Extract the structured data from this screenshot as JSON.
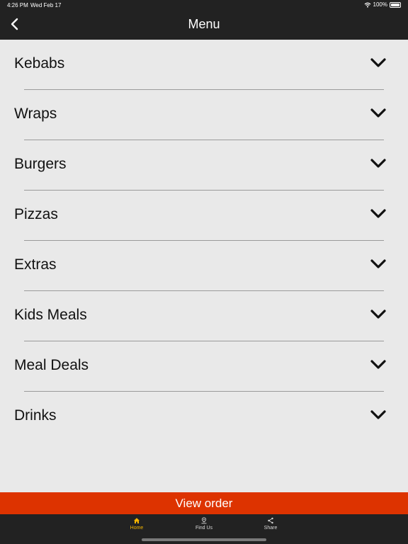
{
  "status_bar": {
    "time": "4:26 PM",
    "date": "Wed Feb 17",
    "battery": "100%"
  },
  "header": {
    "title": "Menu"
  },
  "menu": {
    "items": [
      {
        "label": "Kebabs"
      },
      {
        "label": "Wraps"
      },
      {
        "label": "Burgers"
      },
      {
        "label": "Pizzas"
      },
      {
        "label": "Extras"
      },
      {
        "label": "Kids Meals"
      },
      {
        "label": "Meal Deals"
      },
      {
        "label": "Drinks"
      }
    ]
  },
  "view_order": {
    "label": "View order"
  },
  "tabbar": {
    "tabs": [
      {
        "label": "Home",
        "icon": "home-icon",
        "active": true
      },
      {
        "label": "Find Us",
        "icon": "location-icon",
        "active": false
      },
      {
        "label": "Share",
        "icon": "share-icon",
        "active": false
      }
    ]
  },
  "colors": {
    "accent": "#dd3300",
    "active_tab": "#f4b400",
    "bar_bg": "#222222",
    "page_bg": "#e9e9e9"
  }
}
